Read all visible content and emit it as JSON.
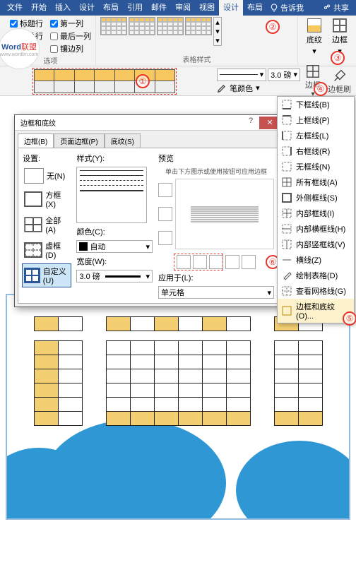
{
  "tabs": {
    "file": "文件",
    "home": "开始",
    "insert": "插入",
    "design": "设计",
    "layout": "布局",
    "ref": "引用",
    "mail": "邮件",
    "review": "审阅",
    "view": "视图",
    "design2": "设计",
    "layout2": "布局",
    "tell": "告诉我",
    "share": "共享"
  },
  "opts": {
    "header_row": "标题行",
    "first_col": "第一列",
    "total_row": "汇总行",
    "last_col": "最后一列",
    "banded_row": "镶行",
    "banded_col": "镶边列",
    "options": "选项"
  },
  "group": {
    "styles": "表格样式"
  },
  "btn": {
    "shading": "底纹",
    "borders": "边框",
    "border_styles": "边框",
    "border_painter": "边框刷"
  },
  "weight": {
    "label": "3.0 磅",
    "pen": "笔颜色"
  },
  "menu": {
    "bottom": "下框线(B)",
    "top": "上框线(P)",
    "left": "左框线(L)",
    "right": "右框线(R)",
    "none": "无框线(N)",
    "all": "所有框线(A)",
    "outside": "外侧框线(S)",
    "inside": "内部框线(I)",
    "ih": "内部横框线(H)",
    "iv": "内部竖框线(V)",
    "diag": "横线(Z)",
    "draw": "绘制表格(D)",
    "grid": "查看网格线(G)",
    "dialog": "边框和底纹(O)..."
  },
  "dlg": {
    "title": "边框和底纹",
    "tab_border": "边框(B)",
    "tab_page": "页面边框(P)",
    "tab_shading": "底纹(S)",
    "setting": "设置:",
    "none": "无(N)",
    "box": "方框(X)",
    "all": "全部(A)",
    "grid": "虚框(D)",
    "custom": "自定义(U)",
    "style": "样式(Y):",
    "color": "颜色(C):",
    "auto": "自动",
    "width": "宽度(W):",
    "w_val": "3.0 磅",
    "preview": "预览",
    "prev_hint": "单击下方图示或使用按钮可应用边框",
    "apply": "应用于(L):",
    "apply_val": "单元格"
  },
  "ann": {
    "1": "①",
    "2": "②",
    "3": "③",
    "4": "④",
    "5": "⑤",
    "6": "⑥"
  },
  "logo": {
    "brand": "Word",
    "suffix": "联盟",
    "url": "www.wordlm.com"
  }
}
